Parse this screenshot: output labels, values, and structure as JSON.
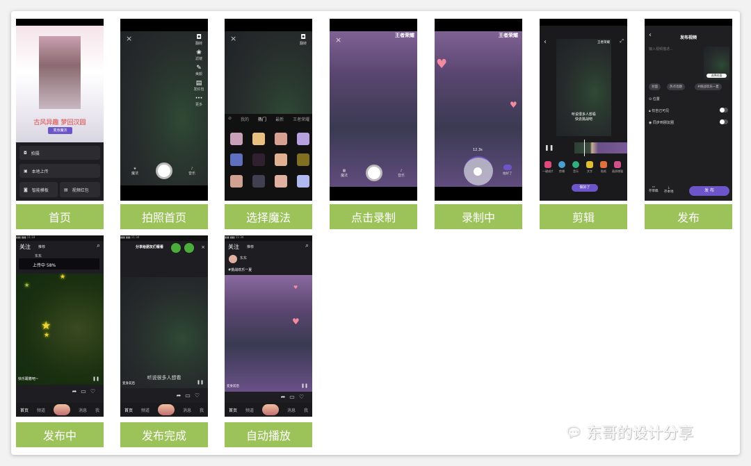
{
  "steps": [
    {
      "label": "首页",
      "banner_title": "古风异趣 梦回汉园",
      "banner_button": "变身魔法",
      "menu": [
        "拍摄",
        "本地上传",
        "智能模板",
        "视频红包"
      ]
    },
    {
      "label": "拍照首页",
      "side": [
        "翻转",
        "滤镜",
        "美颜",
        "发红包",
        "更多"
      ],
      "bottom_left": "魔法",
      "bottom_right": "音乐"
    },
    {
      "label": "选择魔法",
      "side": [
        "翻转"
      ],
      "tabs": [
        "我的",
        "热门",
        "最新",
        "王者荣耀"
      ]
    },
    {
      "label": "点击录制",
      "logo": "王者荣耀",
      "bottom_left": "魔法",
      "bottom_right": "音乐"
    },
    {
      "label": "录制中",
      "logo": "王者荣耀",
      "timer": "12.3s",
      "done": "拍好了"
    },
    {
      "label": "剪辑",
      "logo": "王者荣耀",
      "caption": [
        "听说很多人想看",
        "快去挑战吧"
      ],
      "tools": [
        "一键成片",
        "剪辑",
        "音乐",
        "文字",
        "贴纸",
        "画质增强"
      ],
      "done_button": "做好了"
    },
    {
      "label": "发布",
      "title": "发布视频",
      "placeholder": "输入视频描述...",
      "cover": "选择封面",
      "tags": [
        "封面",
        "热点话题",
        "#挑战欢乐一夏"
      ],
      "location": "位置",
      "private": "仅自己可见",
      "sync": "同步到朋友圈",
      "draft": "存草稿",
      "save_local": "存本地",
      "publish": "发 布"
    },
    {
      "label": "发布中",
      "tabs": [
        "关注",
        "推荐"
      ],
      "user": "东东",
      "upload": "上传中 58%",
      "topic": "快乐跟着吧~",
      "nav": [
        "首页",
        "频道",
        "消息",
        "我"
      ]
    },
    {
      "label": "发布完成",
      "share": "分享给朋友们看看",
      "caption": "听说很多人想看",
      "topic": "变身前后",
      "nav": [
        "首页",
        "频道",
        "消息",
        "我"
      ]
    },
    {
      "label": "自动播放",
      "tabs": [
        "关注",
        "推荐"
      ],
      "user": "东东",
      "hashtag": "#挑战欢乐一夏",
      "topic": "变身前后",
      "nav": [
        "首页",
        "频道",
        "消息",
        "我"
      ]
    }
  ],
  "watermark": "东哥的设计分享",
  "colors": {
    "label_bg": "#9cc35a",
    "accent": "#6c55c8"
  }
}
